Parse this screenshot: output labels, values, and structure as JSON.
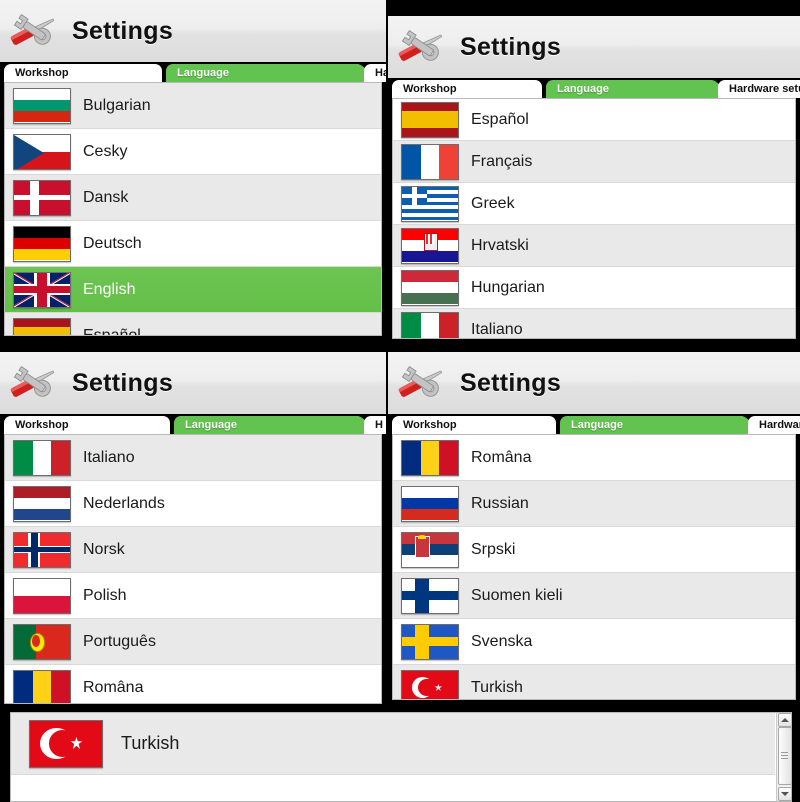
{
  "app": {
    "title": "Settings",
    "icon": "wrench-screwdriver-icon"
  },
  "tabs": [
    {
      "label": "Workshop",
      "active": false
    },
    {
      "label": "Language",
      "active": true
    },
    {
      "label": "Hardware setup",
      "active": false
    }
  ],
  "tab_labels": {
    "workshop": "Workshop",
    "language": "Language",
    "hardware_full": "Hardware setup",
    "hardware_clip_short": "Har",
    "hardware_clip_h": "H",
    "hardware_clip_medium": "Hardware"
  },
  "colors": {
    "accent_green": "#63c350",
    "selected_row_green": "#6ec552",
    "row_alt_gray": "#e9e9e9",
    "row_white": "#ffffff",
    "window_chrome": "#e8e8e8",
    "backdrop_black": "#000000"
  },
  "panels": [
    {
      "id": "panel-top-left",
      "tab_third_label": "Har",
      "rows": [
        {
          "label": "Bulgarian",
          "flag": "bg-flag",
          "selected": false
        },
        {
          "label": "Cesky",
          "flag": "cz-flag",
          "selected": false
        },
        {
          "label": "Dansk",
          "flag": "dk-flag",
          "selected": false
        },
        {
          "label": "Deutsch",
          "flag": "de-flag",
          "selected": false
        },
        {
          "label": "English",
          "flag": "gb-flag",
          "selected": true
        },
        {
          "label": "Español",
          "flag": "es-flag",
          "selected": false
        }
      ]
    },
    {
      "id": "panel-top-right",
      "tab_third_label": "Hardware setup",
      "rows": [
        {
          "label": "Español",
          "flag": "es-flag",
          "selected": false
        },
        {
          "label": "Français",
          "flag": "fr-flag",
          "selected": false
        },
        {
          "label": "Greek",
          "flag": "gr-flag",
          "selected": false
        },
        {
          "label": "Hrvatski",
          "flag": "hr-flag",
          "selected": false
        },
        {
          "label": "Hungarian",
          "flag": "hu-flag",
          "selected": false
        },
        {
          "label": "Italiano",
          "flag": "it-flag",
          "selected": false
        }
      ]
    },
    {
      "id": "panel-bottom-left",
      "tab_third_label": "H",
      "rows": [
        {
          "label": "Italiano",
          "flag": "it-flag",
          "selected": false
        },
        {
          "label": "Nederlands",
          "flag": "nl-flag",
          "selected": false
        },
        {
          "label": "Norsk",
          "flag": "no-flag",
          "selected": false
        },
        {
          "label": "Polish",
          "flag": "pl-flag",
          "selected": false
        },
        {
          "label": "Português",
          "flag": "pt-flag",
          "selected": false
        },
        {
          "label": "Româna",
          "flag": "ro-flag",
          "selected": false
        }
      ]
    },
    {
      "id": "panel-bottom-right",
      "tab_third_label": "Hardware",
      "rows": [
        {
          "label": "Româna",
          "flag": "ro-flag",
          "selected": false
        },
        {
          "label": "Russian",
          "flag": "ru-flag",
          "selected": false
        },
        {
          "label": "Srpski",
          "flag": "rs-flag",
          "selected": false
        },
        {
          "label": "Suomen kieli",
          "flag": "fi-flag",
          "selected": false
        },
        {
          "label": "Svenska",
          "flag": "se-flag",
          "selected": false
        },
        {
          "label": "Turkish",
          "flag": "tr-flag",
          "selected": false
        }
      ]
    },
    {
      "id": "panel-bottom-strip",
      "rows": [
        {
          "label": "Turkish",
          "flag": "tr-flag",
          "selected": false
        }
      ]
    }
  ]
}
